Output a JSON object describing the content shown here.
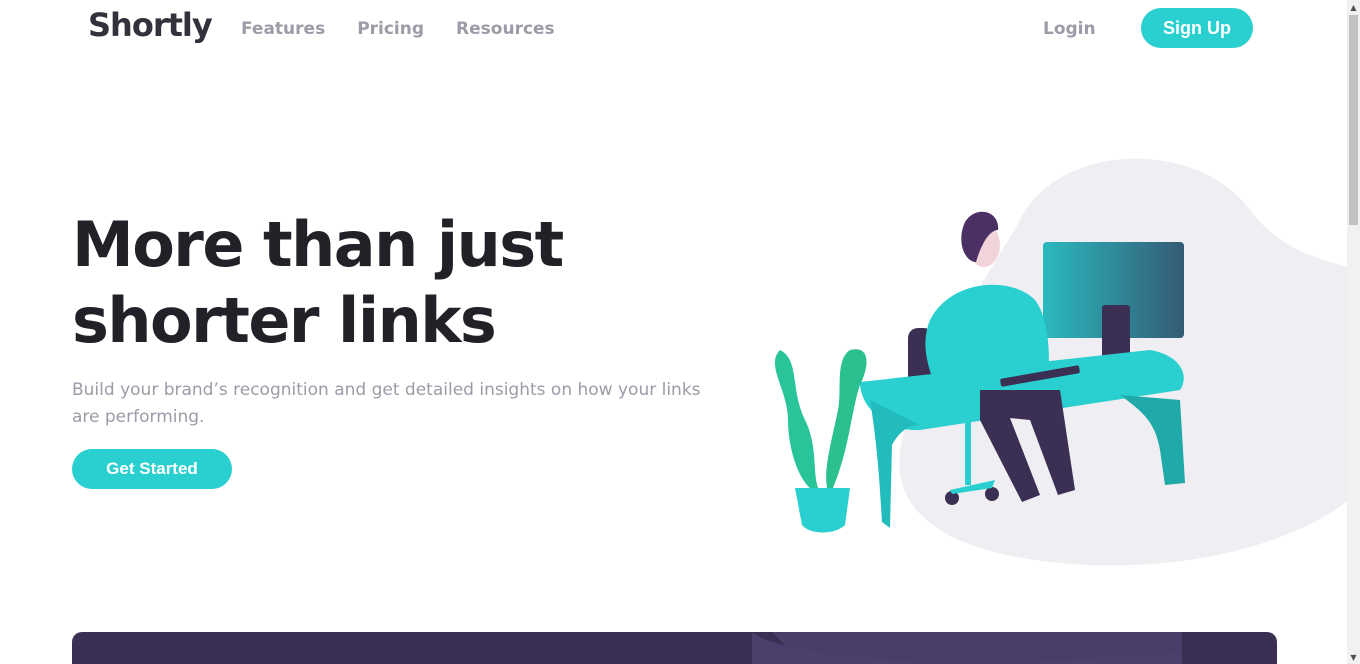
{
  "header": {
    "logo": "Shortly",
    "nav": [
      "Features",
      "Pricing",
      "Resources"
    ],
    "login": "Login",
    "signup": "Sign Up"
  },
  "hero": {
    "title_line1": "More than just",
    "title_line2": "shorter links",
    "text": "Build your brand’s recognition and get detailed insights on how your links are performing.",
    "cta": "Get Started"
  },
  "colors": {
    "cyan": "#2acfcf",
    "dark_violet": "#3b3054",
    "gray": "#9e9aa8",
    "very_dark": "#232127"
  },
  "scrollbar": {
    "up_icon": "▲",
    "down_icon": "▼"
  }
}
